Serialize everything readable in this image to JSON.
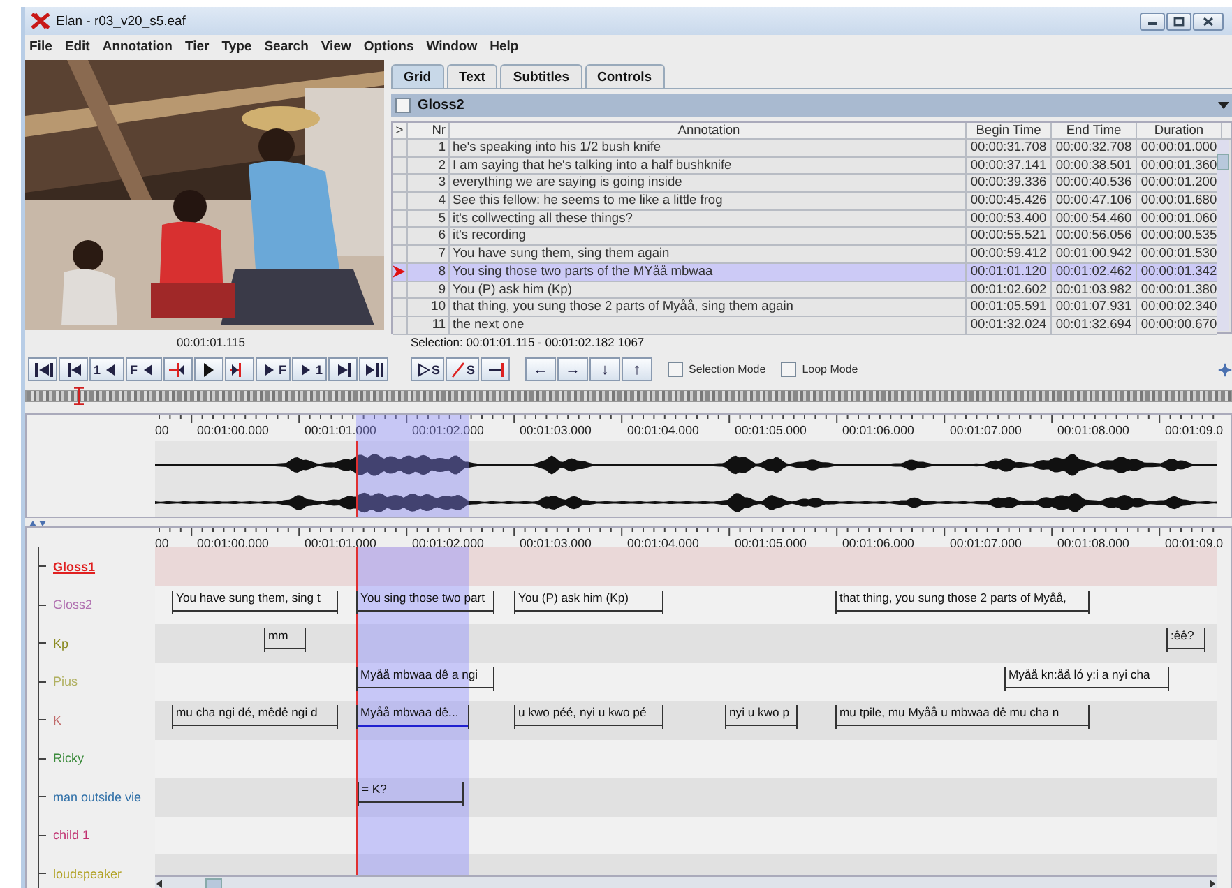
{
  "window": {
    "title": "Elan - r03_v20_s5.eaf"
  },
  "menu": [
    "File",
    "Edit",
    "Annotation",
    "Tier",
    "Type",
    "Search",
    "View",
    "Options",
    "Window",
    "Help"
  ],
  "tabs": [
    {
      "label": "Grid",
      "selected": true
    },
    {
      "label": "Text",
      "selected": false
    },
    {
      "label": "Subtitles",
      "selected": false
    },
    {
      "label": "Controls",
      "selected": false
    }
  ],
  "grid": {
    "tier": "Gloss2",
    "tier_checked": false,
    "columns": [
      ">",
      "Nr",
      "Annotation",
      "Begin Time",
      "End Time",
      "Duration"
    ],
    "rows": [
      {
        "nr": "1",
        "annotation": "he's speaking into his 1/2 bush knife",
        "begin": "00:00:31.708",
        "end": "00:00:32.708",
        "duration": "00:00:01.000",
        "selected": false
      },
      {
        "nr": "2",
        "annotation": "I am saying that he's talking into a half bushknife",
        "begin": "00:00:37.141",
        "end": "00:00:38.501",
        "duration": "00:00:01.360",
        "selected": false
      },
      {
        "nr": "3",
        "annotation": "everything we are saying is going inside",
        "begin": "00:00:39.336",
        "end": "00:00:40.536",
        "duration": "00:00:01.200",
        "selected": false
      },
      {
        "nr": "4",
        "annotation": "See this fellow: he seems to me like a little frog",
        "begin": "00:00:45.426",
        "end": "00:00:47.106",
        "duration": "00:00:01.680",
        "selected": false
      },
      {
        "nr": "5",
        "annotation": "it's  collwecting all these things?",
        "begin": "00:00:53.400",
        "end": "00:00:54.460",
        "duration": "00:00:01.060",
        "selected": false
      },
      {
        "nr": "6",
        "annotation": "it's recording",
        "begin": "00:00:55.521",
        "end": "00:00:56.056",
        "duration": "00:00:00.535",
        "selected": false
      },
      {
        "nr": "7",
        "annotation": "You have sung them, sing them again",
        "begin": "00:00:59.412",
        "end": "00:01:00.942",
        "duration": "00:00:01.530",
        "selected": false
      },
      {
        "nr": "8",
        "annotation": "You sing those two parts of the MYåå mbwaa",
        "begin": "00:01:01.120",
        "end": "00:01:02.462",
        "duration": "00:00:01.342",
        "selected": true
      },
      {
        "nr": "9",
        "annotation": "You (P)  ask him (Kp)",
        "begin": "00:01:02.602",
        "end": "00:01:03.982",
        "duration": "00:00:01.380",
        "selected": false
      },
      {
        "nr": "10",
        "annotation": "that thing, you sung those 2 parts of Myåå, sing them again",
        "begin": "00:01:05.591",
        "end": "00:01:07.931",
        "duration": "00:00:02.340",
        "selected": false
      },
      {
        "nr": "11",
        "annotation": "the next one",
        "begin": "00:01:32.024",
        "end": "00:01:32.694",
        "duration": "00:00:00.670",
        "selected": false
      }
    ]
  },
  "media": {
    "time": "00:01:01.115",
    "selection": "Selection: 00:01:01.115 - 00:01:02.182  1067",
    "player_buttons": [
      {
        "kind": "begin"
      },
      {
        "kind": "prev-page"
      },
      {
        "kind": "prev-step",
        "letter": "1"
      },
      {
        "kind": "prev-step",
        "letter": "F"
      },
      {
        "kind": "prev-boundary"
      },
      {
        "kind": "play"
      },
      {
        "kind": "next-boundary"
      },
      {
        "kind": "next-step",
        "letter": "F"
      },
      {
        "kind": "next-step",
        "letter": "1"
      },
      {
        "kind": "next-page"
      },
      {
        "kind": "end"
      }
    ],
    "selection_buttons": [
      {
        "kind": "play-selection",
        "letter": "S"
      },
      {
        "kind": "clear-selection",
        "letter": "S"
      },
      {
        "kind": "boundary-jump"
      }
    ],
    "arrow_buttons": [
      "←",
      "→",
      "↓",
      "↑"
    ],
    "modes": [
      {
        "label": "Selection Mode",
        "checked": false
      },
      {
        "label": "Loop Mode",
        "checked": false
      }
    ]
  },
  "waveform_ruler": [
    "00",
    "00:01:00.000",
    "00:01:01.000",
    "00:01:02.000",
    "00:01:03.000",
    "00:01:04.000",
    "00:01:05.000",
    "00:01:06.000",
    "00:01:07.000",
    "00:01:08.000",
    "00:01:09.0"
  ],
  "tier_ruler": [
    "00",
    "00:01:00.000",
    "00:01:01.000",
    "00:01:02.000",
    "00:01:03.000",
    "00:01:04.000",
    "00:01:05.000",
    "00:01:06.000",
    "00:01:07.000",
    "00:01:08.000",
    "00:01:09.0"
  ],
  "tiers": [
    {
      "name": "Gloss1",
      "color": "#e02020",
      "active": true
    },
    {
      "name": "Gloss2",
      "color": "#b070b0",
      "active": false,
      "annotations": [
        {
          "text": "You have sung them, sing t",
          "selected": false
        },
        {
          "text": "You sing those two part",
          "selected": false
        },
        {
          "text": "You (P)  ask him (Kp)",
          "selected": false
        },
        {
          "text": "that thing, you sung those 2 parts of Myåå,",
          "selected": false
        }
      ]
    },
    {
      "name": "Kp",
      "color": "#8a8a20",
      "active": false,
      "annotations": [
        {
          "text": "mm",
          "selected": false
        },
        {
          "text": ":êê?",
          "selected": false
        }
      ]
    },
    {
      "name": "Pius",
      "color": "#b0b060",
      "active": false,
      "annotations": [
        {
          "text": "Myåå mbwaa dê a ngi",
          "selected": false
        },
        {
          "text": "Myåå kn:åå ló y:i a nyi cha",
          "selected": false
        }
      ]
    },
    {
      "name": "K",
      "color": "#c06a6a",
      "active": false,
      "annotations": [
        {
          "text": "mu cha ngi dé, mêdê ngi d",
          "selected": false
        },
        {
          "text": "Myåå mbwaa dê...",
          "selected": true
        },
        {
          "text": "u kwo péé, nyi u kwo pé",
          "selected": false
        },
        {
          "text": "nyi u kwo p",
          "selected": false
        },
        {
          "text": "mu tpile, mu Myåå u mbwaa dê mu cha n",
          "selected": false
        }
      ]
    },
    {
      "name": "Ricky",
      "color": "#3a8a3a",
      "active": false
    },
    {
      "name": "man outside vie",
      "color": "#3070a8",
      "active": false,
      "annotations": [
        {
          "text": "= K?",
          "selected": false
        }
      ]
    },
    {
      "name": "child 1",
      "color": "#c03070",
      "active": false
    },
    {
      "name": "loudspeaker",
      "color": "#b0a020",
      "active": false
    }
  ]
}
